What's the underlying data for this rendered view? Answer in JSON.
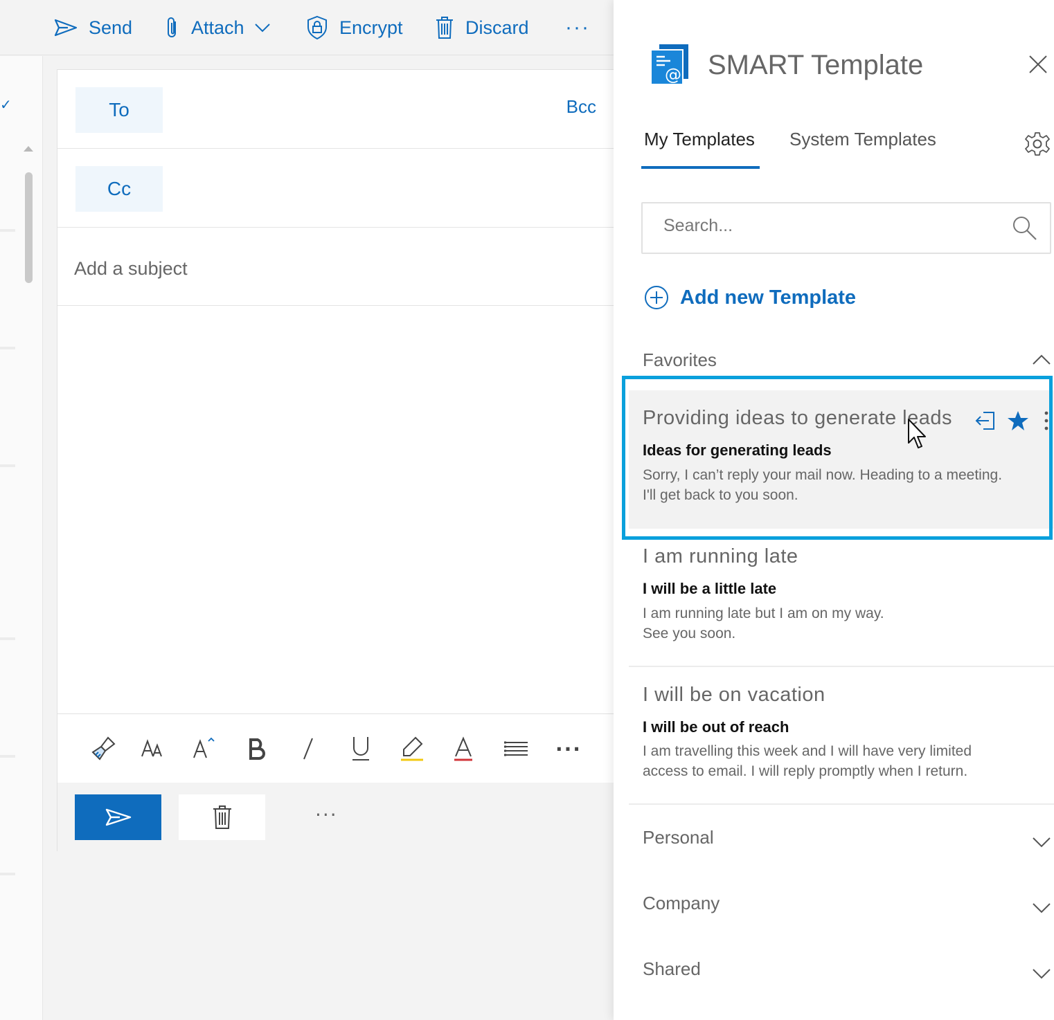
{
  "toolbar": {
    "send_label": "Send",
    "attach_label": "Attach",
    "encrypt_label": "Encrypt",
    "discard_label": "Discard",
    "more_label": "···"
  },
  "compose": {
    "to_label": "To",
    "cc_label": "Cc",
    "bcc_label": "Bcc",
    "subject_placeholder": "Add a subject",
    "more_actions_label": "···",
    "format_more_label": "···"
  },
  "panel": {
    "title": "SMART Template",
    "tabs": [
      {
        "label": "My Templates",
        "active": true
      },
      {
        "label": "System Templates",
        "active": false
      }
    ],
    "search_placeholder": "Search...",
    "add_template_label": "Add new Template",
    "sections": {
      "favorites": "Favorites",
      "personal": "Personal",
      "company": "Company",
      "shared": "Shared"
    },
    "templates": [
      {
        "name": "Providing ideas to generate leads",
        "subject": "Ideas for generating leads",
        "body_line1": "Sorry, I can’t reply your mail now. Heading to a meeting.",
        "body_line2": "I'll get back to you soon."
      },
      {
        "name": "I am running late",
        "subject": "I will be a little late",
        "body_line1": "I am running late but I am on my way.",
        "body_line2": "See you soon."
      },
      {
        "name": "I will be on vacation",
        "subject": "I will be out of reach",
        "body_line1": "I am travelling this week and I will have very limited",
        "body_line2": "access to email. I will reply promptly when I return."
      }
    ]
  },
  "colors": {
    "accent": "#0f6cbd",
    "highlight_border": "#0aa0dc",
    "selected_card_bg": "#f2f2f2"
  }
}
